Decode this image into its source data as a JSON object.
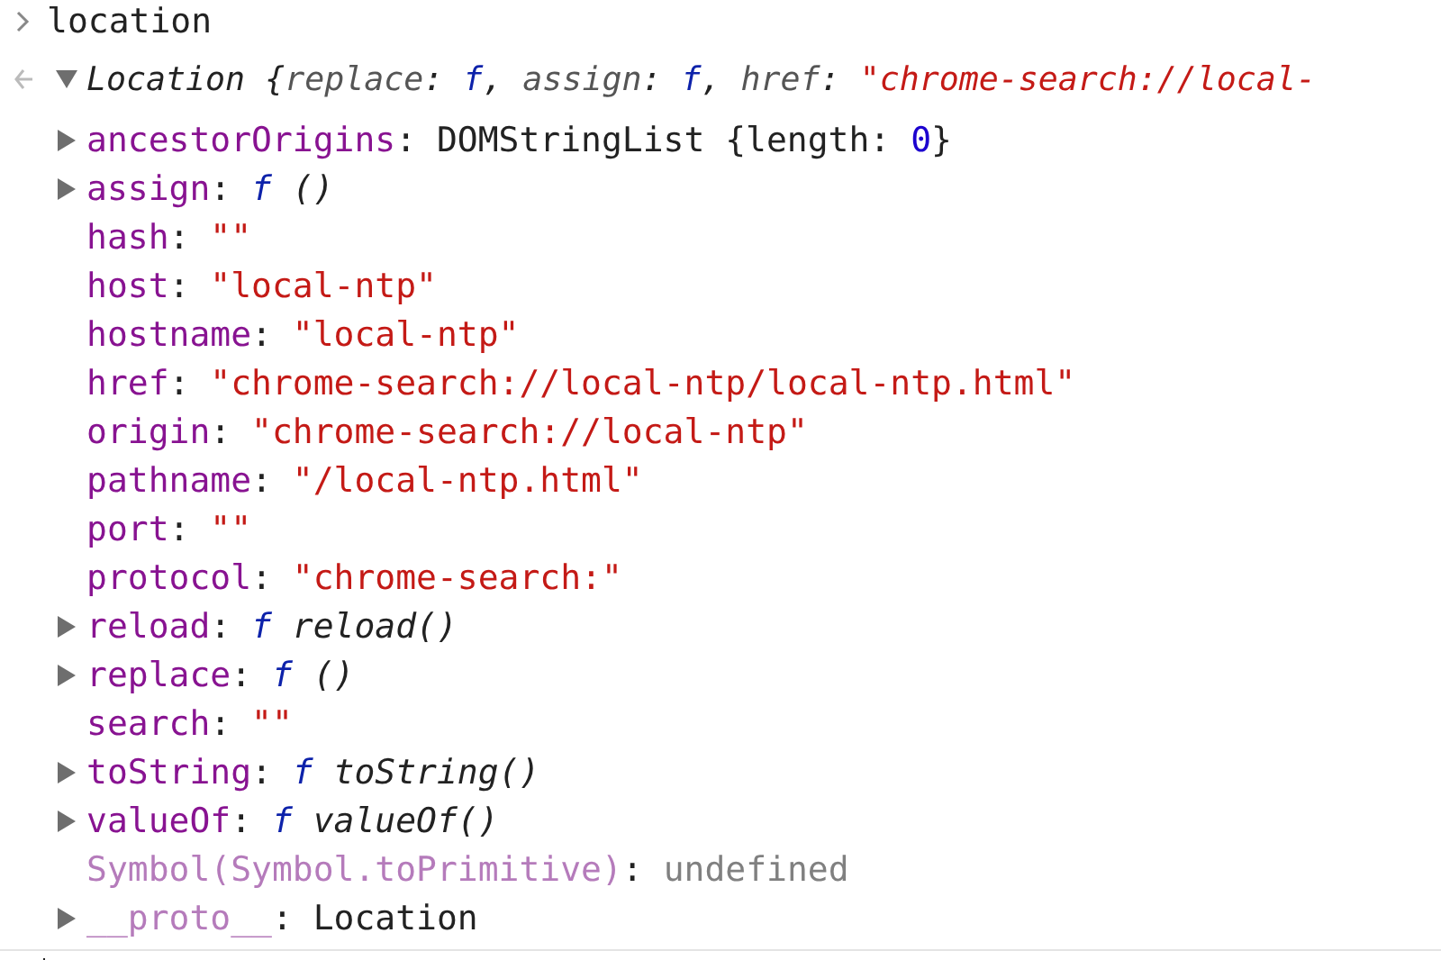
{
  "input": {
    "text": "location"
  },
  "result": {
    "expanded": true,
    "summary": [
      {
        "text": "Location ",
        "kind": "class"
      },
      {
        "text": "{",
        "kind": "plain"
      },
      {
        "text": "replace",
        "kind": "preview-key"
      },
      {
        "text": ": ",
        "kind": "plain"
      },
      {
        "text": "f",
        "kind": "fmark"
      },
      {
        "text": ", ",
        "kind": "plain"
      },
      {
        "text": "assign",
        "kind": "preview-key"
      },
      {
        "text": ": ",
        "kind": "plain"
      },
      {
        "text": "f",
        "kind": "fmark"
      },
      {
        "text": ", ",
        "kind": "plain"
      },
      {
        "text": "href",
        "kind": "preview-key"
      },
      {
        "text": ": ",
        "kind": "plain"
      },
      {
        "text": "\"chrome-search://local-",
        "kind": "string"
      }
    ],
    "properties": [
      {
        "kind": "object",
        "expanded": false,
        "segments": [
          {
            "text": "ancestorOrigins",
            "kind": "key"
          },
          {
            "text": ": DOMStringList {length: ",
            "kind": "plain"
          },
          {
            "text": "0",
            "kind": "number"
          },
          {
            "text": "}",
            "kind": "plain"
          }
        ]
      },
      {
        "kind": "object",
        "expanded": false,
        "segments": [
          {
            "text": "assign",
            "kind": "key"
          },
          {
            "text": ": ",
            "kind": "plain"
          },
          {
            "text": "f",
            "kind": "fmark"
          },
          {
            "text": " ()",
            "kind": "fname"
          }
        ]
      },
      {
        "kind": "primitive",
        "segments": [
          {
            "text": "hash",
            "kind": "key"
          },
          {
            "text": ": ",
            "kind": "plain"
          },
          {
            "text": "\"\"",
            "kind": "string"
          }
        ]
      },
      {
        "kind": "primitive",
        "segments": [
          {
            "text": "host",
            "kind": "key"
          },
          {
            "text": ": ",
            "kind": "plain"
          },
          {
            "text": "\"local-ntp\"",
            "kind": "string"
          }
        ]
      },
      {
        "kind": "primitive",
        "segments": [
          {
            "text": "hostname",
            "kind": "key"
          },
          {
            "text": ": ",
            "kind": "plain"
          },
          {
            "text": "\"local-ntp\"",
            "kind": "string"
          }
        ]
      },
      {
        "kind": "primitive",
        "segments": [
          {
            "text": "href",
            "kind": "key"
          },
          {
            "text": ": ",
            "kind": "plain"
          },
          {
            "text": "\"chrome-search://local-ntp/local-ntp.html\"",
            "kind": "string"
          }
        ]
      },
      {
        "kind": "primitive",
        "segments": [
          {
            "text": "origin",
            "kind": "key"
          },
          {
            "text": ": ",
            "kind": "plain"
          },
          {
            "text": "\"chrome-search://local-ntp\"",
            "kind": "string"
          }
        ]
      },
      {
        "kind": "primitive",
        "segments": [
          {
            "text": "pathname",
            "kind": "key"
          },
          {
            "text": ": ",
            "kind": "plain"
          },
          {
            "text": "\"/local-ntp.html\"",
            "kind": "string"
          }
        ]
      },
      {
        "kind": "primitive",
        "segments": [
          {
            "text": "port",
            "kind": "key"
          },
          {
            "text": ": ",
            "kind": "plain"
          },
          {
            "text": "\"\"",
            "kind": "string"
          }
        ]
      },
      {
        "kind": "primitive",
        "segments": [
          {
            "text": "protocol",
            "kind": "key"
          },
          {
            "text": ": ",
            "kind": "plain"
          },
          {
            "text": "\"chrome-search:\"",
            "kind": "string"
          }
        ]
      },
      {
        "kind": "object",
        "expanded": false,
        "segments": [
          {
            "text": "reload",
            "kind": "key"
          },
          {
            "text": ": ",
            "kind": "plain"
          },
          {
            "text": "f",
            "kind": "fmark"
          },
          {
            "text": " reload()",
            "kind": "fname"
          }
        ]
      },
      {
        "kind": "object",
        "expanded": false,
        "segments": [
          {
            "text": "replace",
            "kind": "key"
          },
          {
            "text": ": ",
            "kind": "plain"
          },
          {
            "text": "f",
            "kind": "fmark"
          },
          {
            "text": " ()",
            "kind": "fname"
          }
        ]
      },
      {
        "kind": "primitive",
        "segments": [
          {
            "text": "search",
            "kind": "key"
          },
          {
            "text": ": ",
            "kind": "plain"
          },
          {
            "text": "\"\"",
            "kind": "string"
          }
        ]
      },
      {
        "kind": "object",
        "expanded": false,
        "segments": [
          {
            "text": "toString",
            "kind": "key"
          },
          {
            "text": ": ",
            "kind": "plain"
          },
          {
            "text": "f",
            "kind": "fmark"
          },
          {
            "text": " toString()",
            "kind": "fname"
          }
        ]
      },
      {
        "kind": "object",
        "expanded": false,
        "segments": [
          {
            "text": "valueOf",
            "kind": "key"
          },
          {
            "text": ": ",
            "kind": "plain"
          },
          {
            "text": "f",
            "kind": "fmark"
          },
          {
            "text": " valueOf()",
            "kind": "fname"
          }
        ]
      },
      {
        "kind": "primitive",
        "segments": [
          {
            "text": "Symbol(Symbol.toPrimitive)",
            "kind": "internal-key"
          },
          {
            "text": ": ",
            "kind": "plain"
          },
          {
            "text": "undefined",
            "kind": "undefined"
          }
        ]
      },
      {
        "kind": "object",
        "expanded": false,
        "segments": [
          {
            "text": "__proto__",
            "kind": "internal-key"
          },
          {
            "text": ": Location",
            "kind": "plain"
          }
        ]
      }
    ]
  }
}
